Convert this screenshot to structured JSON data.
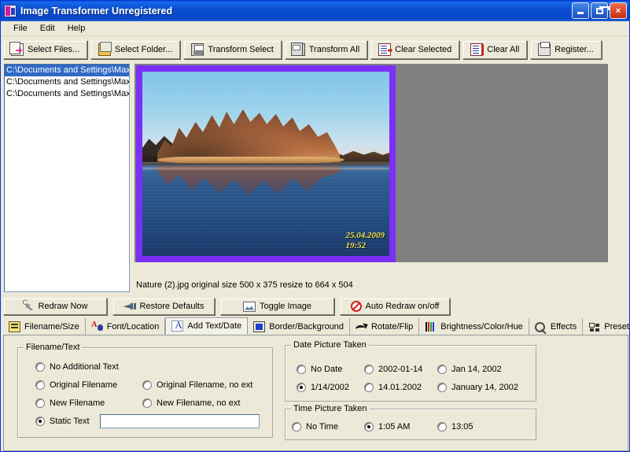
{
  "window": {
    "title": "Image Transformer Unregistered",
    "app_icon": "image-transformer-icon",
    "minimize_label": "Minimize",
    "restore_label": "Restore",
    "close_label": "×"
  },
  "menu": {
    "items": [
      {
        "label": "File"
      },
      {
        "label": "Edit"
      },
      {
        "label": "Help"
      }
    ]
  },
  "toolbar": {
    "buttons": [
      {
        "label": "Select Files...",
        "icon": "select-files-icon"
      },
      {
        "label": "Select Folder...",
        "icon": "select-folder-icon"
      },
      {
        "label": "Transform Select",
        "icon": "transform-select-icon"
      },
      {
        "label": "Transform All",
        "icon": "transform-all-icon"
      },
      {
        "label": "Clear Selected",
        "icon": "clear-selected-icon"
      },
      {
        "label": "Clear All",
        "icon": "clear-all-icon"
      },
      {
        "label": "Register...",
        "icon": "register-icon"
      }
    ]
  },
  "file_list": {
    "items": [
      {
        "path": "C:\\Documents and Settings\\Max",
        "selected": true
      },
      {
        "path": "C:\\Documents and Settings\\Max",
        "selected": false
      },
      {
        "path": "C:\\Documents and Settings\\Max",
        "selected": false
      }
    ]
  },
  "preview": {
    "stamp_date": "25.04.2009",
    "stamp_time": "19:52",
    "caption": "Nature (2).jpg original size 500 x 375 resize to 664 x 504",
    "border_color": "#7b2ff7",
    "canvas_color": "#808080"
  },
  "actions": {
    "buttons": [
      {
        "label": "Redraw Now",
        "icon": "redraw-icon"
      },
      {
        "label": "Restore Defaults",
        "icon": "restore-defaults-icon"
      },
      {
        "label": "Toggle Image",
        "icon": "toggle-image-icon"
      },
      {
        "label": "Auto Redraw on/off",
        "icon": "auto-redraw-icon"
      }
    ]
  },
  "tabs": {
    "items": [
      {
        "label": "Filename/Size",
        "icon": "filename-size-icon",
        "active": false
      },
      {
        "label": "Font/Location",
        "icon": "font-location-icon",
        "active": false
      },
      {
        "label": "Add Text/Date",
        "icon": "add-text-date-icon",
        "active": true
      },
      {
        "label": "Border/Background",
        "icon": "border-background-icon",
        "active": false
      },
      {
        "label": "Rotate/Flip",
        "icon": "rotate-flip-icon",
        "active": false
      },
      {
        "label": "Brightness/Color/Hue",
        "icon": "brightness-color-hue-icon",
        "active": false
      },
      {
        "label": "Effects",
        "icon": "effects-icon",
        "active": false
      },
      {
        "label": "Presets",
        "icon": "presets-icon",
        "active": false
      }
    ]
  },
  "filename_text": {
    "group_title": "Filename/Text",
    "options": [
      {
        "label": "No Additional Text",
        "checked": false
      },
      {
        "label": "Original Filename",
        "checked": false
      },
      {
        "label": "Original Filename, no ext",
        "checked": false
      },
      {
        "label": "New Filename",
        "checked": false
      },
      {
        "label": "New Filename, no ext",
        "checked": false
      },
      {
        "label": "Static Text",
        "checked": true
      }
    ],
    "static_text_value": "",
    "static_text_placeholder": ""
  },
  "date_picture_taken": {
    "group_title": "Date Picture Taken",
    "options": [
      {
        "label": "No Date",
        "checked": false
      },
      {
        "label": "2002-01-14",
        "checked": false
      },
      {
        "label": "Jan 14, 2002",
        "checked": false
      },
      {
        "label": "1/14/2002",
        "checked": true
      },
      {
        "label": "14.01.2002",
        "checked": false
      },
      {
        "label": "January 14, 2002",
        "checked": false
      }
    ]
  },
  "time_picture_taken": {
    "group_title": "Time Picture Taken",
    "options": [
      {
        "label": "No Time",
        "checked": false
      },
      {
        "label": "1:05 AM",
        "checked": true
      },
      {
        "label": "13:05",
        "checked": false
      }
    ]
  }
}
